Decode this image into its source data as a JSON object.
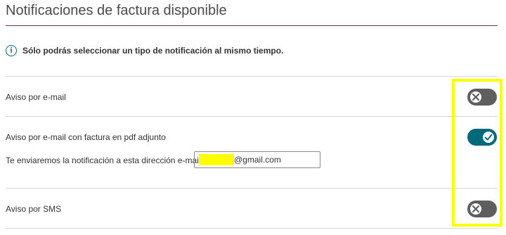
{
  "header": {
    "title": "Notificaciones de factura disponible"
  },
  "info": {
    "icon": "info-icon",
    "text": "Sólo podrás seleccionar un tipo de notificación al mismo tiempo."
  },
  "options": [
    {
      "label": "Aviso por e-mail",
      "enabled": false
    },
    {
      "label": "Aviso por e-mail con factura en pdf adjunto",
      "enabled": true,
      "email_prompt": "Te enviaremos la notificación a esta dirección e-mail",
      "email_domain": "@gmail.com"
    },
    {
      "label": "Aviso por SMS",
      "enabled": false
    }
  ],
  "colors": {
    "accent": "#00697c",
    "toggle_off": "#5e5e5e",
    "rule": "#6b2c4a",
    "highlight": "#ffff00",
    "redaction": "#ffff00"
  }
}
